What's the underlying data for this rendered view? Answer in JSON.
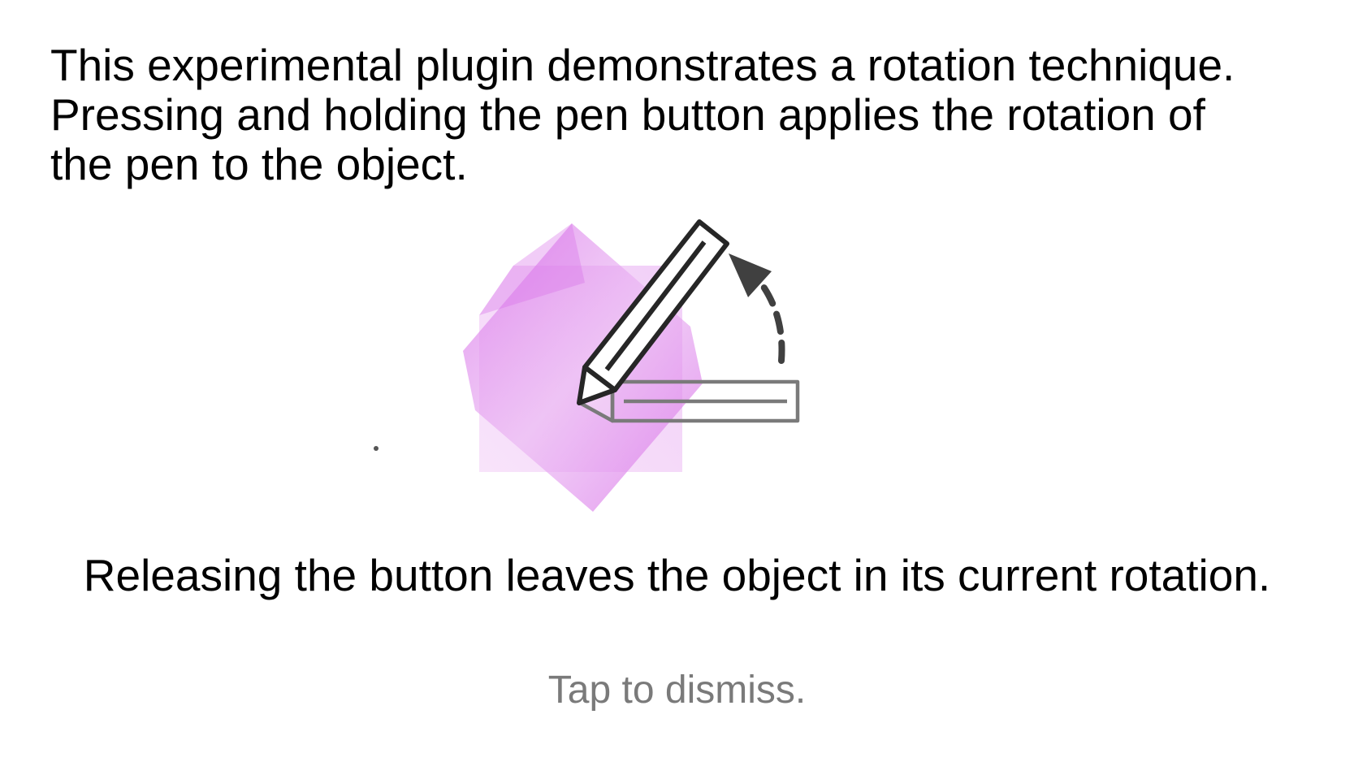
{
  "intro": {
    "lines": [
      "This experimental plugin demonstrates a rotation technique.",
      "Pressing and holding the pen button applies the rotation of",
      "the pen to the object."
    ]
  },
  "illustration": {
    "object_color": "#d76ce8",
    "pen_color": "#262626",
    "ghost_pen_color": "#7a7a7a",
    "arrow_color": "#404040",
    "icons": [
      "rotated-object",
      "pen-icon",
      "ghost-pen-icon",
      "rotation-arrow-icon"
    ]
  },
  "release": {
    "text": "Releasing the button leaves the object in its current rotation."
  },
  "dismiss": {
    "label": "Tap to dismiss."
  }
}
